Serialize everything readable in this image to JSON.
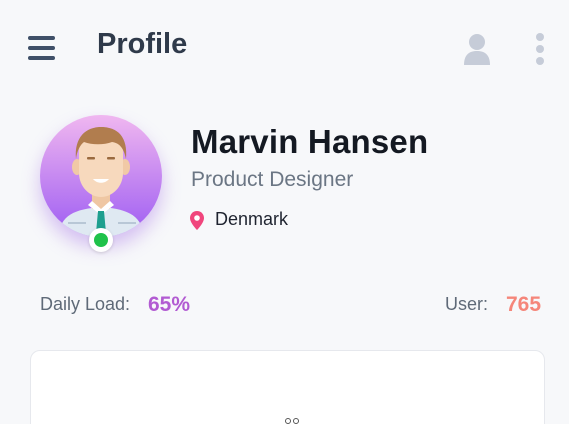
{
  "header": {
    "title": "Profile",
    "menu_icon": "hamburger-menu-icon",
    "user_icon": "user-icon",
    "more_icon": "more-vertical-icon"
  },
  "profile": {
    "name": "Marvin Hansen",
    "role": "Product Designer",
    "location": "Denmark",
    "avatar_icon": "avatar-illustration",
    "status": "online",
    "status_color": "#1fc24a",
    "pin_color": "#f0457c"
  },
  "stats": {
    "daily_load_label": "Daily Load:",
    "daily_load_value": "65%",
    "daily_load_color": "#b25bd2",
    "user_label": "User:",
    "user_value": "765",
    "user_color": "#f5867a"
  },
  "colors": {
    "background": "#f7f8fa",
    "avatar_gradient_top": "#f0b7f0",
    "avatar_gradient_bottom": "#9d5cf2"
  }
}
